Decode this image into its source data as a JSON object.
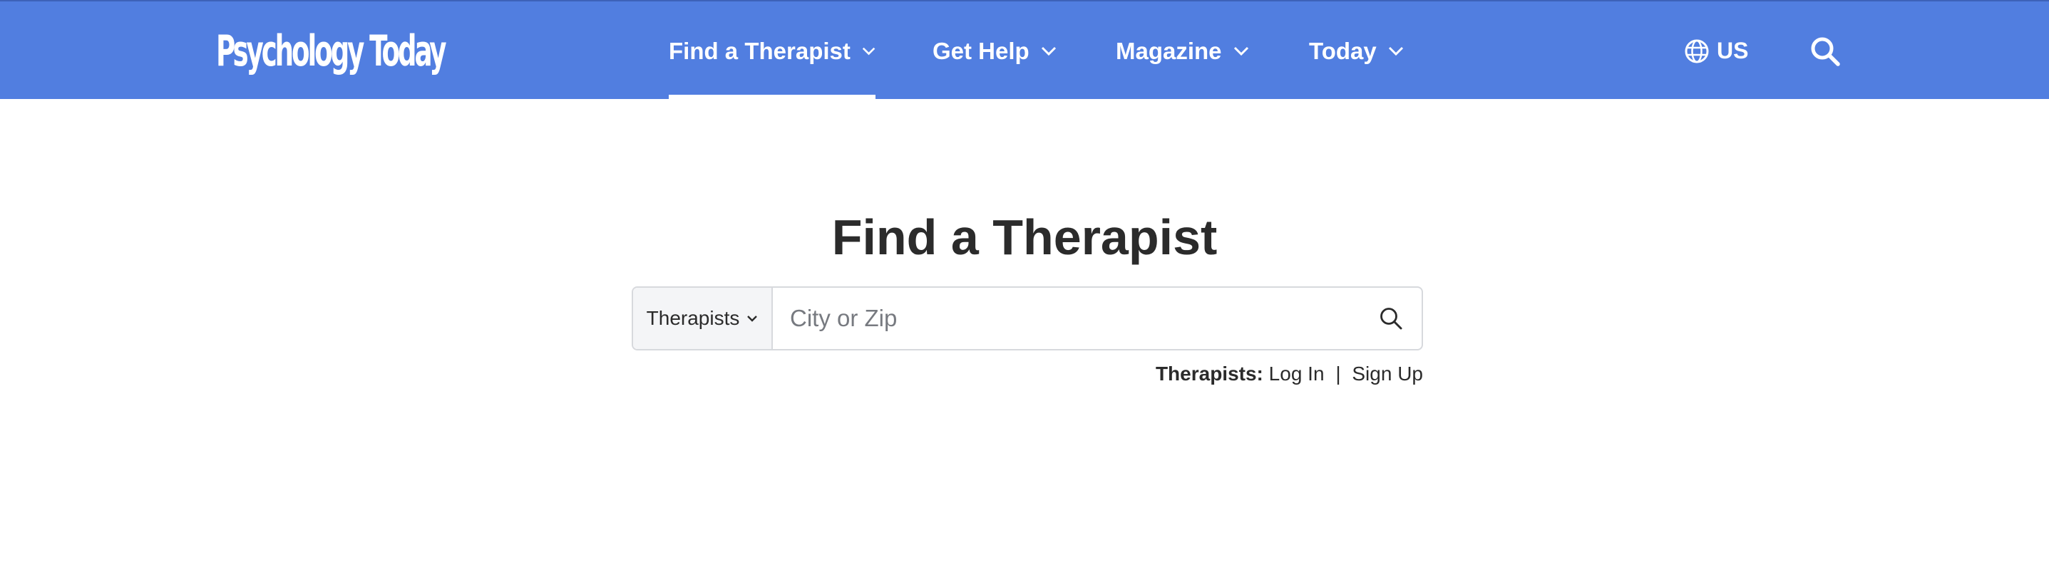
{
  "header": {
    "logo_text": "Psychology Today",
    "nav": [
      {
        "label": "Find a Therapist",
        "active": true
      },
      {
        "label": "Get Help",
        "active": false
      },
      {
        "label": "Magazine",
        "active": false
      },
      {
        "label": "Today",
        "active": false
      }
    ],
    "locale_label": "US",
    "icons": {
      "locale": "globe-icon",
      "search": "search-icon",
      "dropdown": "chevron-down-icon"
    }
  },
  "main": {
    "title": "Find a Therapist",
    "search": {
      "type_selected": "Therapists",
      "placeholder": "City or Zip",
      "value": ""
    },
    "pro_links": {
      "label": "Therapists:",
      "login": "Log In",
      "separator": "|",
      "signup": "Sign Up"
    }
  },
  "colors": {
    "header_bg": "#517ee0",
    "text": "#2b2b2b",
    "input_border": "#d7d9dd",
    "select_bg": "#f4f5f7"
  }
}
